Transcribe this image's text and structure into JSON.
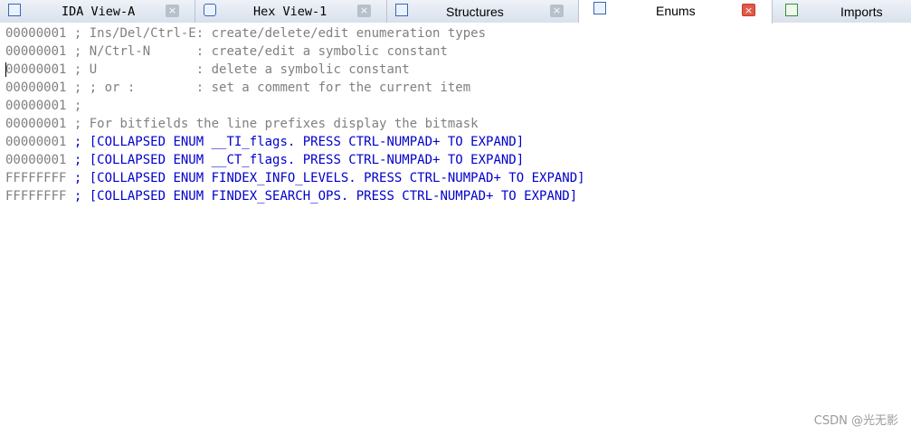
{
  "tabs": [
    {
      "label": "IDA View-A",
      "icon": "ida-view-icon",
      "active": false,
      "closable": true
    },
    {
      "label": "Hex View-1",
      "icon": "hex-view-icon",
      "active": false,
      "closable": true
    },
    {
      "label": "Structures",
      "icon": "structures-icon",
      "active": false,
      "closable": true
    },
    {
      "label": "Enums",
      "icon": "enums-icon",
      "active": true,
      "closable": true
    },
    {
      "label": "Imports",
      "icon": "imports-icon",
      "active": false,
      "closable": false
    }
  ],
  "close_glyph": "×",
  "lines": [
    {
      "addr": "00000001",
      "text": " ; Ins/Del/Ctrl-E: create/delete/edit enumeration types",
      "collapsed": false
    },
    {
      "addr": "00000001",
      "text": " ; N/Ctrl-N      : create/edit a symbolic constant",
      "collapsed": false
    },
    {
      "addr": "00000001",
      "text": " ; U             : delete a symbolic constant",
      "collapsed": false
    },
    {
      "addr": "00000001",
      "text": " ; ; or :        : set a comment for the current item",
      "collapsed": false
    },
    {
      "addr": "00000001",
      "text": " ;",
      "collapsed": false
    },
    {
      "addr": "00000001",
      "text": " ; For bitfields the line prefixes display the bitmask",
      "collapsed": false
    },
    {
      "addr": "00000001",
      "text": " ; [COLLAPSED ENUM __TI_flags. PRESS CTRL-NUMPAD+ TO EXPAND]",
      "collapsed": true
    },
    {
      "addr": "00000001",
      "text": " ; [COLLAPSED ENUM __CT_flags. PRESS CTRL-NUMPAD+ TO EXPAND]",
      "collapsed": true
    },
    {
      "addr": "FFFFFFFF",
      "text": " ; [COLLAPSED ENUM FINDEX_INFO_LEVELS. PRESS CTRL-NUMPAD+ TO EXPAND]",
      "collapsed": true
    },
    {
      "addr": "FFFFFFFF",
      "text": " ; [COLLAPSED ENUM FINDEX_SEARCH_OPS. PRESS CTRL-NUMPAD+ TO EXPAND]",
      "collapsed": true
    }
  ],
  "colors": {
    "address": "#808080",
    "comment": "#808080",
    "collapsed_enum": "#0000cc"
  },
  "watermark": "CSDN @光无影"
}
